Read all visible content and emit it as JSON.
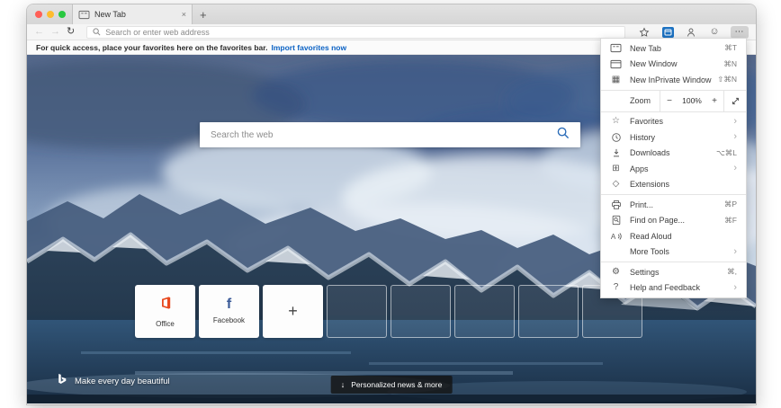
{
  "chrome": {
    "tab": {
      "title": "New Tab",
      "close": "×",
      "new_tab_button": "+"
    },
    "toolbar": {
      "back": "←",
      "forward": "→",
      "refresh": "↻",
      "address_placeholder": "Search or enter web address",
      "more_label": "⋯"
    },
    "favorites_bar": {
      "message": "For quick access, place your favorites here on the favorites bar.",
      "link": "Import favorites now"
    }
  },
  "newtab": {
    "search_placeholder": "Search the web",
    "tiles": [
      {
        "label": "Office"
      },
      {
        "label": "Facebook"
      }
    ],
    "add_tile": "+",
    "promo_text": "Make every day beautiful",
    "news_button": {
      "icon": "↓",
      "label": "Personalized news & more"
    }
  },
  "menu": {
    "items_nav": [
      {
        "label": "New Tab",
        "shortcut": "⌘T"
      },
      {
        "label": "New Window",
        "shortcut": "⌘N"
      },
      {
        "label": "New InPrivate Window",
        "shortcut": "⇧⌘N"
      }
    ],
    "zoom": {
      "label": "Zoom",
      "out": "−",
      "level": "100%",
      "in": "+"
    },
    "items_lib": [
      {
        "label": "Favorites",
        "chevron": "›"
      },
      {
        "label": "History",
        "chevron": "›"
      },
      {
        "label": "Downloads",
        "shortcut": "⌥⌘L"
      },
      {
        "label": "Apps",
        "chevron": "›"
      },
      {
        "label": "Extensions"
      }
    ],
    "items_tools": [
      {
        "label": "Print...",
        "shortcut": "⌘P"
      },
      {
        "label": "Find on Page...",
        "shortcut": "⌘F"
      },
      {
        "label": "Read Aloud"
      },
      {
        "label": "More Tools",
        "chevron": "›"
      }
    ],
    "items_bottom": [
      {
        "label": "Settings",
        "shortcut": "⌘,"
      },
      {
        "label": "Help and Feedback",
        "chevron": "›"
      }
    ],
    "icon_glyphs": {
      "inprivate": "▦",
      "favorites": "☆",
      "apps": "⊞",
      "extensions": "◇",
      "settings": "⚙",
      "help": "?",
      "smiley": "☺"
    }
  },
  "colors": {
    "accent_blue": "#1d72c2",
    "link_blue": "#0b62c4",
    "facebook_blue": "#3a5a98",
    "office_orange": "#e8491f"
  }
}
